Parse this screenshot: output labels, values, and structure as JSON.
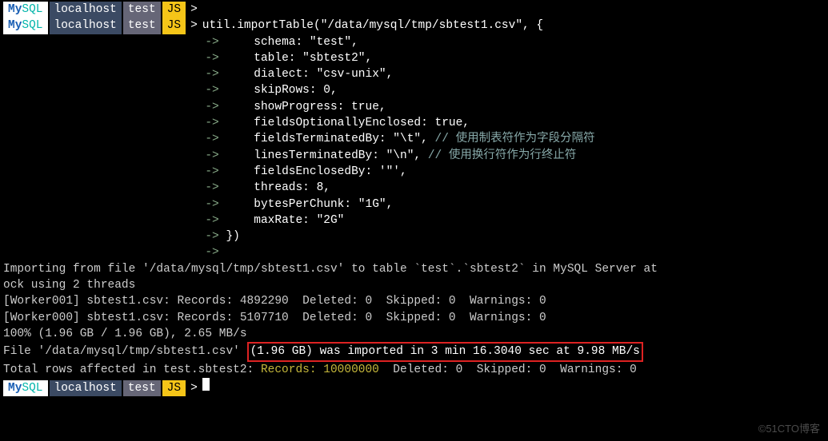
{
  "prompt": {
    "mysql": "My",
    "sql": "SQL",
    "host": "localhost",
    "db": "test",
    "mode": "JS",
    "gt": ">"
  },
  "command": {
    "call": "util.importTable(\"/data/mysql/tmp/sbtest1.csv\", {",
    "opts": [
      "schema: \"test\",",
      "table: \"sbtest2\",",
      "dialect: \"csv-unix\",",
      "skipRows: 0,",
      "showProgress: true,",
      "fieldsOptionallyEnclosed: true,",
      "fieldsTerminatedBy: \"\\t\", // 使用制表符作为字段分隔符",
      "linesTerminatedBy: \"\\n\", // 使用换行符作为行终止符",
      "fieldsEnclosedBy: '\"',",
      "threads: 8,",
      "bytesPerChunk: \"1G\",",
      "maxRate: \"2G\""
    ],
    "close1": "})",
    "close2": ""
  },
  "arrow": "->",
  "output": {
    "importing": "Importing from file '/data/mysql/tmp/sbtest1.csv' to table `test`.`sbtest2` in MySQL Server at",
    "importing2": "ock using 2 threads",
    "worker1": "[Worker001] sbtest1.csv: Records: 4892290  Deleted: 0  Skipped: 0  Warnings: 0",
    "worker0": "[Worker000] sbtest1.csv: Records: 5107710  Deleted: 0  Skipped: 0  Warnings: 0",
    "progress": "100% (1.96 GB / 1.96 GB), 2.65 MB/s",
    "file_prefix": "File '/data/mysql/tmp/sbtest1.csv' ",
    "file_highlight": "(1.96 GB) was imported in 3 min 16.3040 sec at 9.98 MB/s",
    "total_pre": "Total rows affected in test.sbtest2: ",
    "total_records": "Records: 10000000 ",
    "total_post": " Deleted: 0  Skipped: 0  Warnings: 0"
  },
  "watermark": "©51CTO博客"
}
